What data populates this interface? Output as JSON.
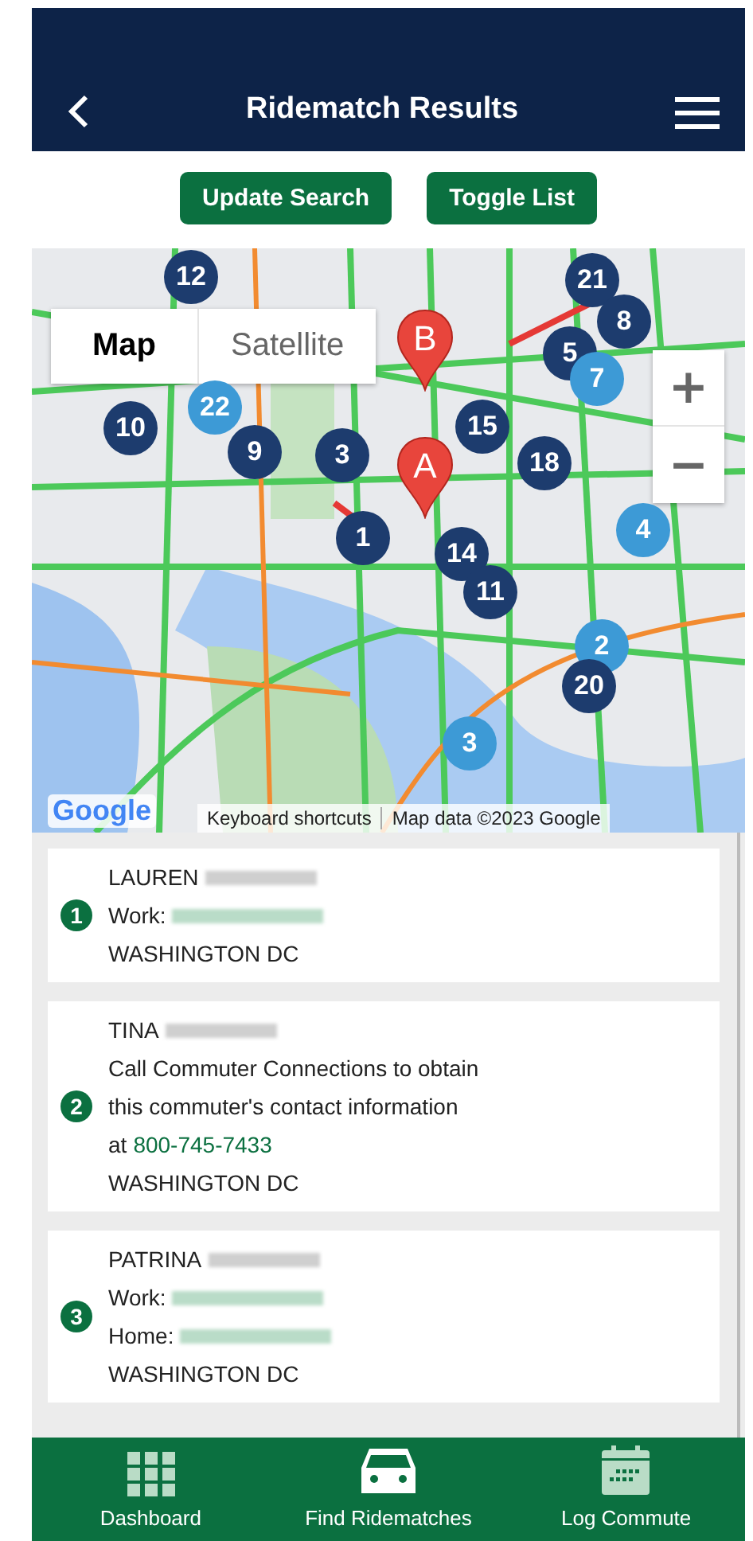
{
  "header": {
    "title": "Ridematch Results"
  },
  "actions": [
    "Update Search",
    "Toggle List"
  ],
  "map": {
    "map_types": [
      {
        "label": "Map",
        "selected": true
      },
      {
        "label": "Satellite",
        "selected": false
      }
    ],
    "zoom_in": "+",
    "zoom_out": "−",
    "pins": [
      {
        "label": "B"
      },
      {
        "label": "A"
      }
    ],
    "markers": [
      {
        "label": "12",
        "color": "#1d3c6e"
      },
      {
        "label": "10",
        "color": "#1d3c6e"
      },
      {
        "label": "22",
        "color": "#3d9ad6"
      },
      {
        "label": "9",
        "color": "#1d3c6e"
      },
      {
        "label": "3",
        "color": "#1d3c6e"
      },
      {
        "label": "15",
        "color": "#1d3c6e"
      },
      {
        "label": "18",
        "color": "#1d3c6e"
      },
      {
        "label": "21",
        "color": "#1d3c6e"
      },
      {
        "label": "8",
        "color": "#1d3c6e"
      },
      {
        "label": "5",
        "color": "#1d3c6e"
      },
      {
        "label": "7",
        "color": "#3d9ad6"
      },
      {
        "label": "1",
        "color": "#1d3c6e"
      },
      {
        "label": "14",
        "color": "#1d3c6e"
      },
      {
        "label": "11",
        "color": "#1d3c6e"
      },
      {
        "label": "4",
        "color": "#3d9ad6"
      },
      {
        "label": "2",
        "color": "#3d9ad6"
      },
      {
        "label": "20",
        "color": "#1d3c6e"
      },
      {
        "label": "3",
        "color": "#3d9ad6"
      }
    ],
    "logo": "Google",
    "attribution": [
      "Keyboard shortcuts",
      "Map data ©2023 Google"
    ]
  },
  "results": [
    {
      "number": "1",
      "lines": [
        {
          "kind": "name",
          "text": "LAUREN"
        },
        {
          "kind": "phone",
          "label": "Work:"
        },
        {
          "kind": "text",
          "text": "WASHINGTON DC"
        }
      ]
    },
    {
      "number": "2",
      "lines": [
        {
          "kind": "name",
          "text": "TINA"
        },
        {
          "kind": "text",
          "text": "Call Commuter Connections to obtain"
        },
        {
          "kind": "text",
          "text": "this commuter's contact information"
        },
        {
          "kind": "call",
          "prefix": "at",
          "phone": "800-745-7433"
        },
        {
          "kind": "text",
          "text": "WASHINGTON DC"
        }
      ]
    },
    {
      "number": "3",
      "lines": [
        {
          "kind": "name",
          "text": "PATRINA"
        },
        {
          "kind": "phone",
          "label": "Work:"
        },
        {
          "kind": "phone",
          "label": "Home:"
        },
        {
          "kind": "text",
          "text": "WASHINGTON DC"
        }
      ]
    }
  ],
  "tabs": [
    {
      "label": "Dashboard",
      "selected": false
    },
    {
      "label": "Find Ridematches",
      "selected": true
    },
    {
      "label": "Log Commute",
      "selected": false
    }
  ]
}
